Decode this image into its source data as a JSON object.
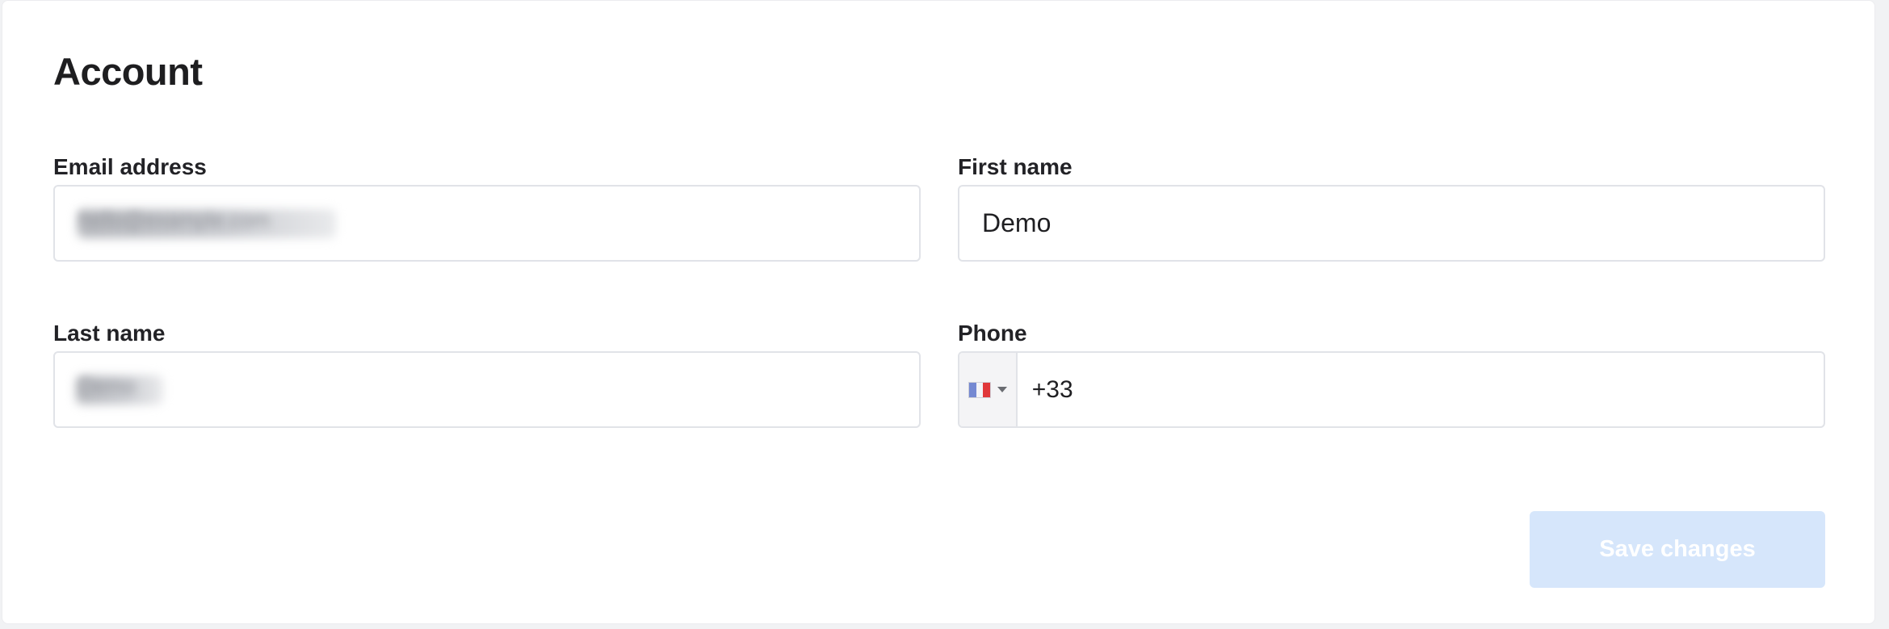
{
  "account": {
    "title": "Account",
    "email": {
      "label": "Email address",
      "value_hidden": "hello@example.com"
    },
    "first_name": {
      "label": "First name",
      "value": "Demo"
    },
    "last_name": {
      "label": "Last name",
      "value_hidden": "Demo"
    },
    "phone": {
      "label": "Phone",
      "country_flag": "france-flag-icon",
      "value": "+33"
    },
    "save_label": "Save changes"
  },
  "colors": {
    "button_disabled_bg": "#d6e6fb",
    "input_border": "#e1e3e8",
    "heading": "#1e1e20"
  }
}
